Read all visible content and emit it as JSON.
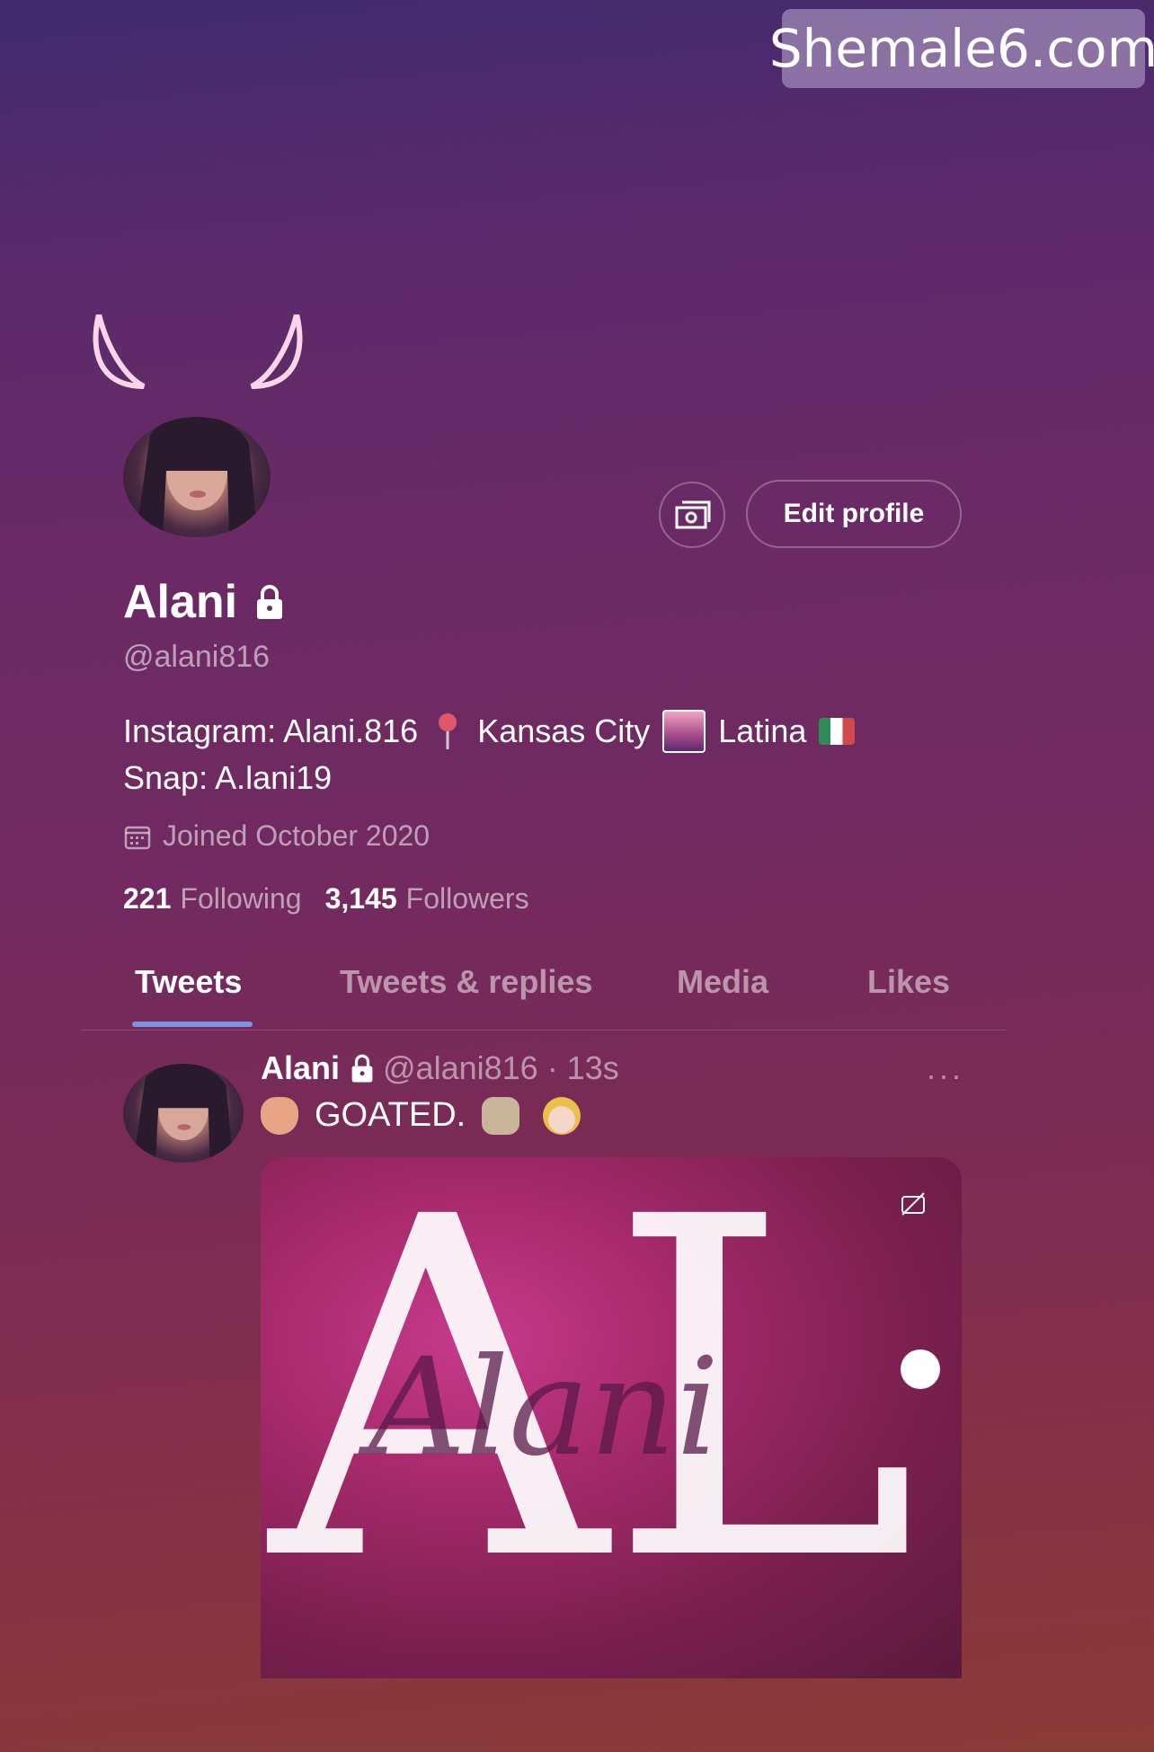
{
  "watermark": {
    "text": "Shemale6.com"
  },
  "profile": {
    "name": "Alani",
    "handle": "@alani816",
    "bio_line1_a": "Instagram: Alani.816",
    "bio_line1_b": "Kansas City",
    "bio_line1_c": "Latina",
    "bio_line2": "Snap: A.lani19",
    "joined": "Joined October 2020",
    "following_count": "221",
    "following_label": "Following",
    "followers_count": "3,145",
    "followers_label": "Followers",
    "edit_label": "Edit profile"
  },
  "tabs": [
    {
      "label": "Tweets",
      "active": true
    },
    {
      "label": "Tweets & replies",
      "active": false
    },
    {
      "label": "Media",
      "active": false
    },
    {
      "label": "Likes",
      "active": false
    }
  ],
  "tweet": {
    "name": "Alani",
    "meta": "@alani816 · 13s",
    "text": "GOATED.",
    "more": "···",
    "media_text": "AL",
    "media_script": "Alani"
  },
  "colors": {
    "tab_underline": "#7b95e6",
    "text_primary": "#ffffff"
  },
  "icons": [
    "lock-icon",
    "calendar-icon",
    "money-icon",
    "more-icon",
    "captions-icon"
  ]
}
